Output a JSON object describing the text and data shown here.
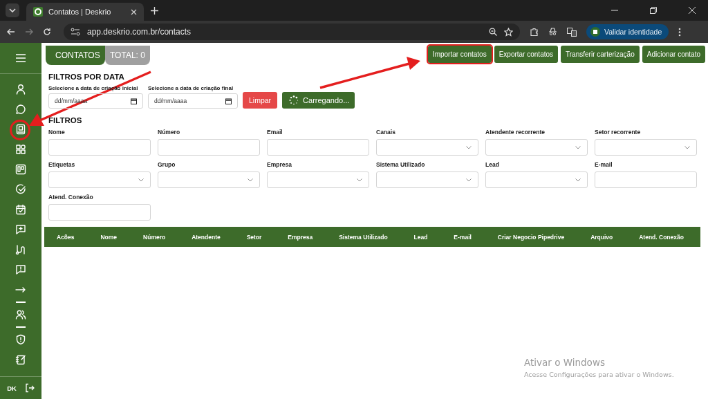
{
  "browser": {
    "tab_title": "Contatos | Deskrio",
    "url": "app.deskrio.com.br/contacts",
    "profile_button": "Validar identidade"
  },
  "sidebar": {
    "user_initials": "DK"
  },
  "header": {
    "tabs": [
      {
        "label": "CONTATOS",
        "kind": "title"
      },
      {
        "label": "TOTAL: 0",
        "kind": "count"
      }
    ],
    "actions": [
      {
        "label": "Importar contatos",
        "highlighted": true
      },
      {
        "label": "Exportar contatos",
        "highlighted": false
      },
      {
        "label": "Transferir carterização",
        "highlighted": false
      },
      {
        "label": "Adicionar contato",
        "highlighted": false
      }
    ]
  },
  "date_filters": {
    "title": "FILTROS POR DATA",
    "fields": [
      {
        "label": "Selecione a data de criação inicial",
        "placeholder": "dd/mm/aaaa"
      },
      {
        "label": "Selecione a data de criação final",
        "placeholder": "dd/mm/aaaa"
      }
    ],
    "buttons": [
      {
        "label": "Limpar",
        "kind": "clear"
      },
      {
        "label": "Carregando...",
        "kind": "loading"
      }
    ]
  },
  "filters": {
    "title": "FILTROS",
    "fields": [
      {
        "label": "Nome",
        "kind": "text"
      },
      {
        "label": "Número",
        "kind": "text"
      },
      {
        "label": "Email",
        "kind": "text"
      },
      {
        "label": "Canais",
        "kind": "select"
      },
      {
        "label": "Atendente recorrente",
        "kind": "select"
      },
      {
        "label": "Setor recorrente",
        "kind": "select"
      },
      {
        "label": "Etiquetas",
        "kind": "select"
      },
      {
        "label": "Grupo",
        "kind": "select"
      },
      {
        "label": "Empresa",
        "kind": "select"
      },
      {
        "label": "Sistema Utilizado",
        "kind": "select"
      },
      {
        "label": "Lead",
        "kind": "select"
      },
      {
        "label": "E-mail",
        "kind": "text"
      },
      {
        "label": "Atend. Conexão",
        "kind": "text"
      }
    ]
  },
  "table": {
    "columns": [
      "Acões",
      "Nome",
      "Número",
      "Atendente",
      "Setor",
      "Empresa",
      "Sistema Utilizado",
      "Lead",
      "E-mail",
      "Criar Negocio Pipedrive",
      "Arquivo",
      "Atend. Conexão"
    ]
  },
  "os_notice": {
    "title": "Ativar o Windows",
    "text": "Acesse Configurações para ativar o Windows."
  }
}
